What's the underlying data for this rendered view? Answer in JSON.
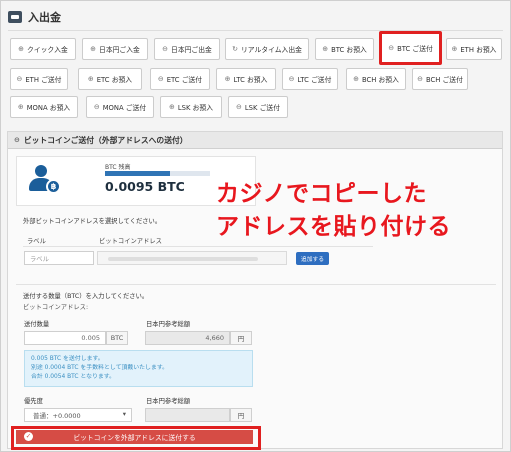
{
  "page": {
    "title": "入出金",
    "wallet_icon": "wallet-icon"
  },
  "tabs": [
    {
      "label": "クイック入金",
      "icon": "deposit-icon"
    },
    {
      "label": "日本円ご入金",
      "icon": "deposit-icon"
    },
    {
      "label": "日本円ご出金",
      "icon": "withdraw-icon"
    },
    {
      "label": "リアルタイム入出金",
      "icon": "realtime-icon"
    },
    {
      "label": "BTC お預入",
      "icon": "deposit-icon"
    },
    {
      "label": "BTC ご送付",
      "icon": "send-icon",
      "active": true
    },
    {
      "label": "ETH お預入",
      "icon": "deposit-icon"
    },
    {
      "label": "ETH ご送付",
      "icon": "send-icon"
    },
    {
      "label": "ETC お預入",
      "icon": "deposit-icon"
    },
    {
      "label": "ETC ご送付",
      "icon": "send-icon"
    },
    {
      "label": "LTC お預入",
      "icon": "deposit-icon"
    },
    {
      "label": "LTC ご送付",
      "icon": "send-icon"
    },
    {
      "label": "BCH お預入",
      "icon": "deposit-icon"
    },
    {
      "label": "BCH ご送付",
      "icon": "send-icon"
    },
    {
      "label": "MONA お預入",
      "icon": "deposit-icon"
    },
    {
      "label": "MONA ご送付",
      "icon": "send-icon"
    },
    {
      "label": "LSK お預入",
      "icon": "deposit-icon"
    },
    {
      "label": "LSK ご送付",
      "icon": "send-icon"
    }
  ],
  "panel": {
    "title": "ビットコインご送付（外部アドレスへの送付）"
  },
  "balance": {
    "label": "BTC 残高",
    "value": "0.0095 BTC",
    "bar_fill_fraction": 0.62
  },
  "address_section": {
    "heading": "外部ビットコインアドレスを選択してください。",
    "col_label": "ラベル",
    "col_address": "ビットコインアドレス",
    "label_placeholder": "ラベル",
    "add_button": "追加する"
  },
  "overlay": {
    "line1": "カジノでコピーした",
    "line2": "アドレスを貼り付ける"
  },
  "amount_section": {
    "heading": "送付する数量（BTC）を入力してください。",
    "sub": "ビットコインアドレス:",
    "qty_label": "送付数量",
    "qty_value": "0.005",
    "qty_unit": "BTC",
    "jpy_label": "日本円参考総額",
    "jpy_value": "4,660",
    "jpy_unit": "円"
  },
  "info": {
    "line1": "0.005 BTC を送付します。",
    "line2": "別途 0.0004 BTC を手数料として頂戴いたします。",
    "line3": "合計 0.0054 BTC となります。"
  },
  "priority": {
    "label": "優先度",
    "selected": "普通：+0.0000",
    "jpy_label": "日本円参考総額",
    "jpy_unit": "円"
  },
  "submit": {
    "label": "ビットコインを外部アドレスに送付する"
  },
  "colors": {
    "accent_red": "#e02020",
    "overlay_red": "#e8171e",
    "brand_blue": "#1b5e9a",
    "submit_red": "#d64c45"
  }
}
